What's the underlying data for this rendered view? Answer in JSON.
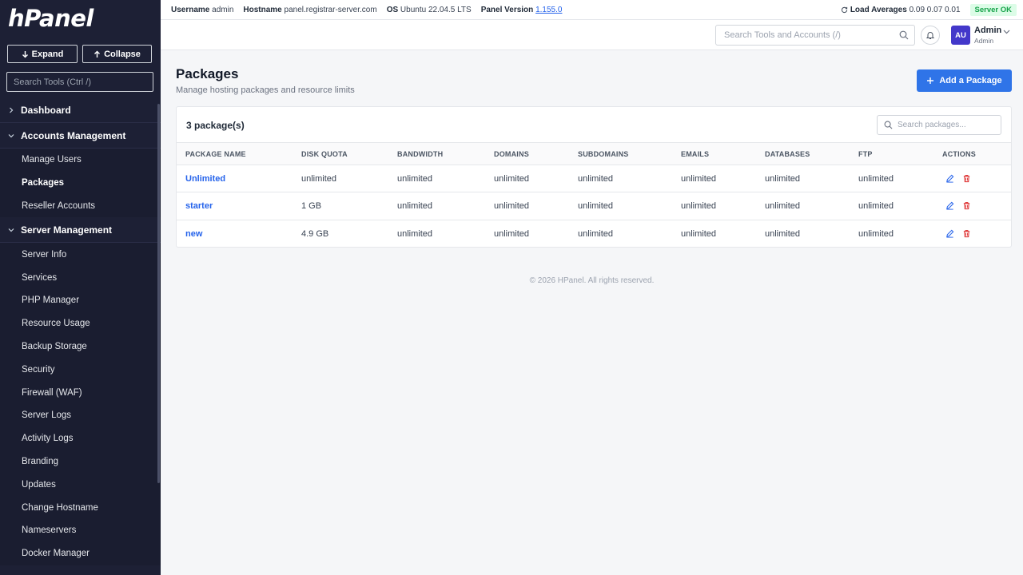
{
  "sidebar": {
    "logo": "hPanel",
    "expand_label": "Expand",
    "collapse_label": "Collapse",
    "search_placeholder": "Search Tools (Ctrl /)",
    "dashboard_label": "Dashboard",
    "accounts_label": "Accounts Management",
    "accounts_items": [
      "Manage Users",
      "Packages",
      "Reseller Accounts"
    ],
    "server_label": "Server Management",
    "server_items": [
      "Server Info",
      "Services",
      "PHP Manager",
      "Resource Usage",
      "Backup Storage",
      "Security",
      "Firewall (WAF)",
      "Server Logs",
      "Activity Logs",
      "Branding",
      "Updates",
      "Change Hostname",
      "Nameservers",
      "Docker Manager"
    ]
  },
  "topbar": {
    "username_label": "Username",
    "username_value": "admin",
    "hostname_label": "Hostname",
    "hostname_value": "panel.registrar-server.com",
    "os_label": "OS",
    "os_value": "Ubuntu 22.04.5 LTS",
    "panel_version_label": "Panel Version",
    "panel_version_value": "1.155.0",
    "load_label": "Load Averages",
    "load_value": "0.09 0.07 0.01",
    "status": "Server OK"
  },
  "header": {
    "search_placeholder": "Search Tools and Accounts (/)",
    "avatar_initials": "AU",
    "user_name": "Admin",
    "user_role": "Admin"
  },
  "main": {
    "title": "Packages",
    "subtitle": "Manage hosting packages and resource limits",
    "add_button": "Add a Package",
    "count": "3 package(s)",
    "search_placeholder": "Search packages...",
    "columns": [
      "PACKAGE NAME",
      "DISK QUOTA",
      "BANDWIDTH",
      "DOMAINS",
      "SUBDOMAINS",
      "EMAILS",
      "DATABASES",
      "FTP",
      "ACTIONS"
    ],
    "rows": [
      [
        "Unlimited",
        "unlimited",
        "unlimited",
        "unlimited",
        "unlimited",
        "unlimited",
        "unlimited",
        "unlimited"
      ],
      [
        "starter",
        "1 GB",
        "unlimited",
        "unlimited",
        "unlimited",
        "unlimited",
        "unlimited",
        "unlimited"
      ],
      [
        "new",
        "4.9 GB",
        "unlimited",
        "unlimited",
        "unlimited",
        "unlimited",
        "unlimited",
        "unlimited"
      ]
    ]
  },
  "footer": "© 2026 HPanel. All rights reserved.",
  "colors": {
    "sidebar_bg": "#1d2035",
    "accent": "#2f74e8",
    "link": "#2563eb",
    "danger": "#dc2626",
    "ok": "#16a34a"
  },
  "icons": [
    "arrow-down-icon",
    "arrow-up-icon",
    "chevron-right-icon",
    "chevron-down-icon",
    "refresh-icon",
    "search-icon",
    "bell-icon",
    "plus-icon",
    "edit-icon",
    "trash-icon"
  ]
}
